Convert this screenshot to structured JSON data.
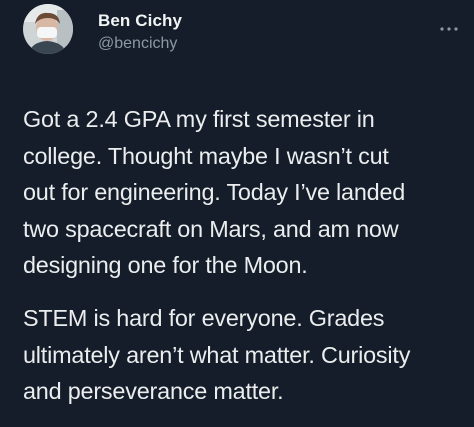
{
  "author": {
    "name": "Ben Cichy",
    "handle": "@bencichy",
    "avatar_icon": "avatar-photo"
  },
  "menu_icon": "more-horizontal-icon",
  "tweet": {
    "paragraph1": [
      "Got a 2.4 GPA my first semester in",
      "college. Thought maybe I wasn’t cut",
      "out for engineering. Today I’ve landed",
      "two spacecraft on Mars, and am now",
      "designing one for the Moon."
    ],
    "paragraph2": [
      "STEM is hard for everyone. Grades",
      "ultimately aren’t what matter.  Curiosity",
      "and perseverance matter."
    ]
  },
  "colors": {
    "background": "#141d29",
    "text": "#ebedee",
    "secondary": "#8b98a5"
  }
}
